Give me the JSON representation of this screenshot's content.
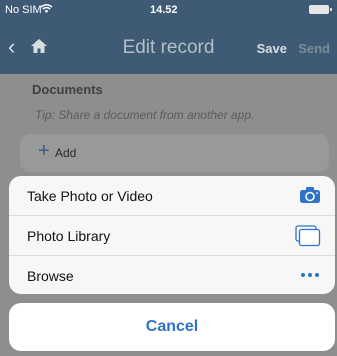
{
  "status_bar": {
    "carrier": "No SIM",
    "time": "14.52"
  },
  "nav": {
    "title": "Edit record",
    "save_label": "Save",
    "send_label": "Send"
  },
  "documents": {
    "header": "Documents",
    "tip": "Tip: Share a document from another app.",
    "add_label": "Add"
  },
  "action_sheet": {
    "items": [
      {
        "label": "Take Photo or Video",
        "icon": "camera-icon"
      },
      {
        "label": "Photo Library",
        "icon": "photo-library-icon"
      },
      {
        "label": "Browse",
        "icon": "more-dots-icon"
      }
    ],
    "cancel_label": "Cancel"
  },
  "colors": {
    "accent": "#2f73c8",
    "nav_background": "#3e5a74"
  }
}
